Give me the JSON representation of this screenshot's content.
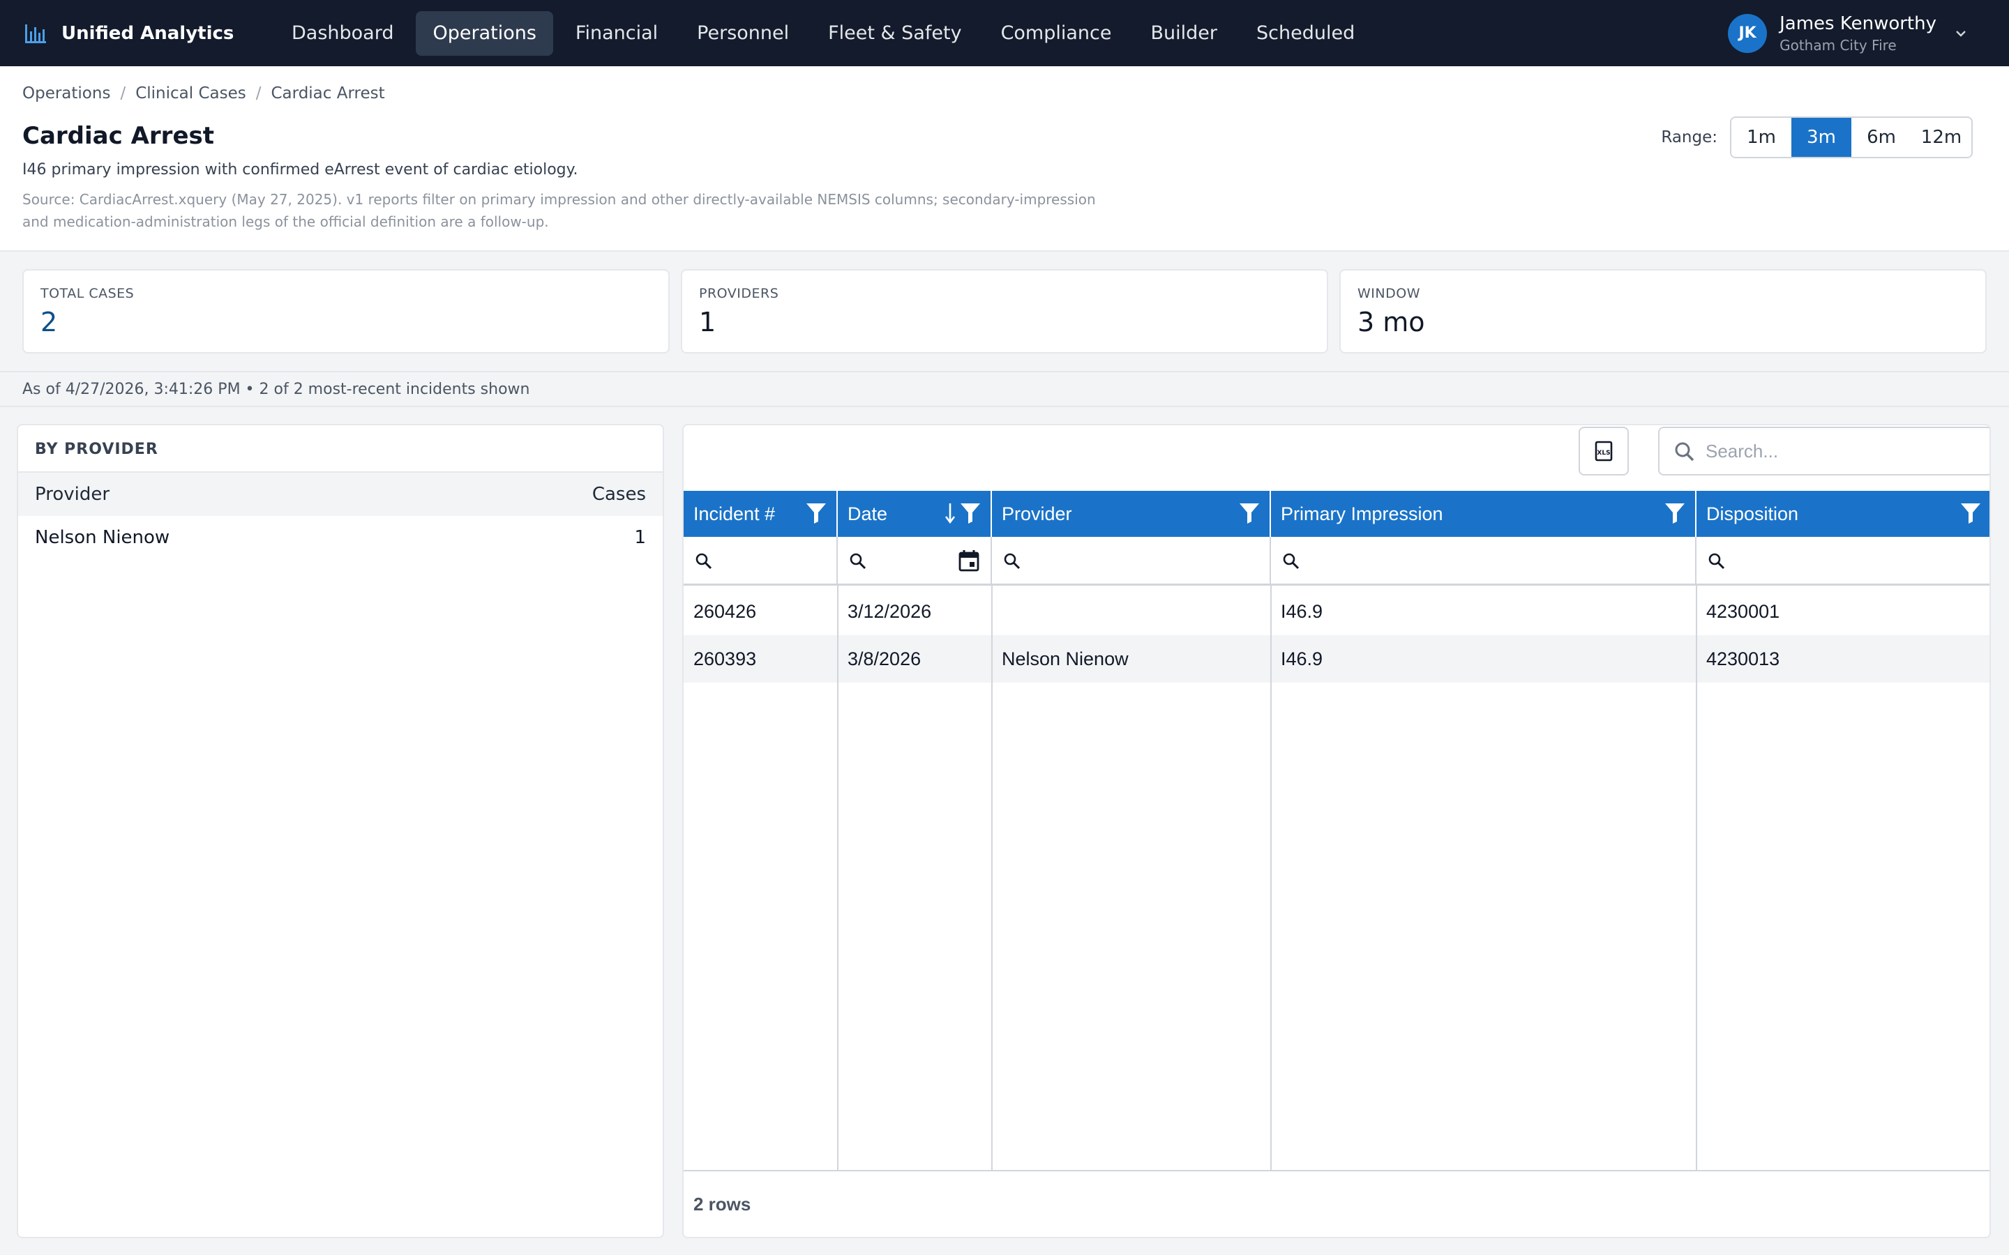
{
  "nav": {
    "brand": "Unified Analytics",
    "items": [
      "Dashboard",
      "Operations",
      "Financial",
      "Personnel",
      "Fleet & Safety",
      "Compliance",
      "Builder",
      "Scheduled"
    ],
    "active": "Operations"
  },
  "user": {
    "initials": "JK",
    "name": "James Kenworthy",
    "org": "Gotham City Fire"
  },
  "breadcrumb": [
    "Operations",
    "Clinical Cases",
    "Cardiac Arrest"
  ],
  "page": {
    "title": "Cardiac Arrest",
    "description": "I46 primary impression with confirmed eArrest event of cardiac etiology.",
    "source": "Source: CardiacArrest.xquery (May 27, 2025). v1 reports filter on primary impression and other directly-available NEMSIS columns; secondary-impression and medication-administration legs of the official definition are a follow-up."
  },
  "range": {
    "label": "Range:",
    "options": [
      "1m",
      "3m",
      "6m",
      "12m"
    ],
    "selected": "3m"
  },
  "stats": {
    "total_cases": {
      "label": "TOTAL CASES",
      "value": "2"
    },
    "providers": {
      "label": "PROVIDERS",
      "value": "1"
    },
    "window": {
      "label": "WINDOW",
      "value": "3 mo"
    }
  },
  "status": "As of 4/27/2026, 3:41:26 PM • 2 of 2 most-recent incidents shown",
  "by_provider": {
    "title": "BY PROVIDER",
    "columns": {
      "provider": "Provider",
      "cases": "Cases"
    },
    "rows": [
      {
        "provider": "Nelson Nienow",
        "cases": "1"
      }
    ]
  },
  "grid": {
    "search_placeholder": "Search...",
    "columns": [
      "Incident #",
      "Date",
      "Provider",
      "Primary Impression",
      "Disposition"
    ],
    "rows": [
      [
        "260426",
        "3/12/2026",
        "",
        "I46.9",
        "4230001"
      ],
      [
        "260393",
        "3/8/2026",
        "Nelson Nienow",
        "I46.9",
        "4230013"
      ]
    ],
    "footer": "2 rows"
  },
  "colors": {
    "nav_bg": "#131b2c",
    "accent": "#1a73c8",
    "stat_accent": "#0c4f8a"
  }
}
